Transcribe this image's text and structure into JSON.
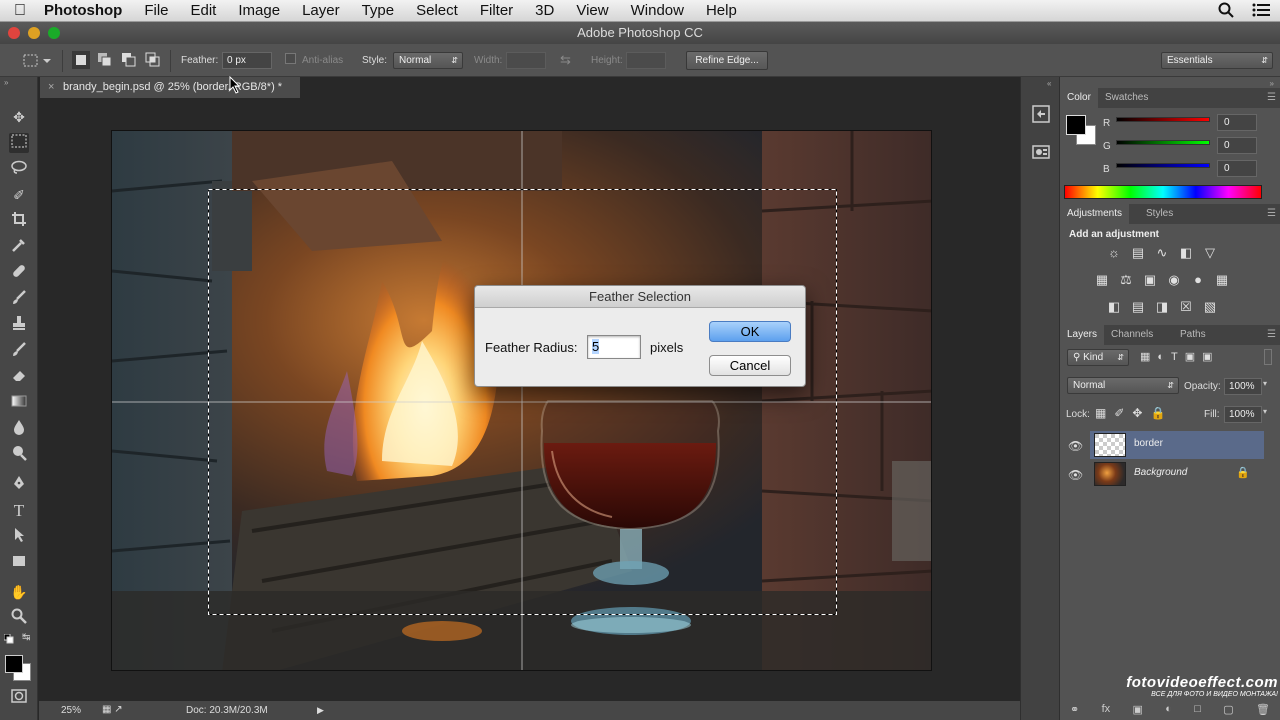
{
  "menubar": {
    "app": "Photoshop",
    "items": [
      "File",
      "Edit",
      "Image",
      "Layer",
      "Type",
      "Select",
      "Filter",
      "3D",
      "View",
      "Window",
      "Help"
    ]
  },
  "window": {
    "title": "Adobe Photoshop CC"
  },
  "options": {
    "feather_label": "Feather:",
    "feather_value": "0 px",
    "antialias_label": "Anti-alias",
    "style_label": "Style:",
    "style_value": "Normal",
    "width_label": "Width:",
    "height_label": "Height:",
    "refine_edge": "Refine Edge...",
    "workspace": "Essentials"
  },
  "document": {
    "tab_title": "brandy_begin.psd @ 25% (border, RGB/8*) *",
    "zoom": "25%",
    "doc_size": "Doc: 20.3M/20.3M"
  },
  "dialog": {
    "title": "Feather Selection",
    "label": "Feather Radius:",
    "value": "5",
    "unit": "pixels",
    "ok": "OK",
    "cancel": "Cancel"
  },
  "color_panel": {
    "tabs": [
      "Color",
      "Swatches"
    ],
    "r_label": "R",
    "g_label": "G",
    "b_label": "B",
    "r": "0",
    "g": "0",
    "b": "0",
    "foreground": "#000000",
    "background": "#ffffff"
  },
  "adjustments_panel": {
    "tabs": [
      "Adjustments",
      "Styles"
    ],
    "heading": "Add an adjustment"
  },
  "layers_panel": {
    "tabs": [
      "Layers",
      "Channels",
      "Paths"
    ],
    "filter_kind": "Kind",
    "blend_mode": "Normal",
    "opacity_label": "Opacity:",
    "opacity": "100%",
    "lock_label": "Lock:",
    "fill_label": "Fill:",
    "fill": "100%",
    "layers": [
      {
        "name": "border",
        "selected": true
      },
      {
        "name": "Background",
        "selected": false,
        "locked": true
      }
    ]
  },
  "watermark": {
    "brand": "fotovideoeffect.com",
    "tagline": "ВСЕ ДЛЯ ФОТО И ВИДЕО МОНТАЖА!"
  },
  "colors": {
    "selected_layer": "#5a6a8a",
    "ok_button": "#5da0ee"
  }
}
